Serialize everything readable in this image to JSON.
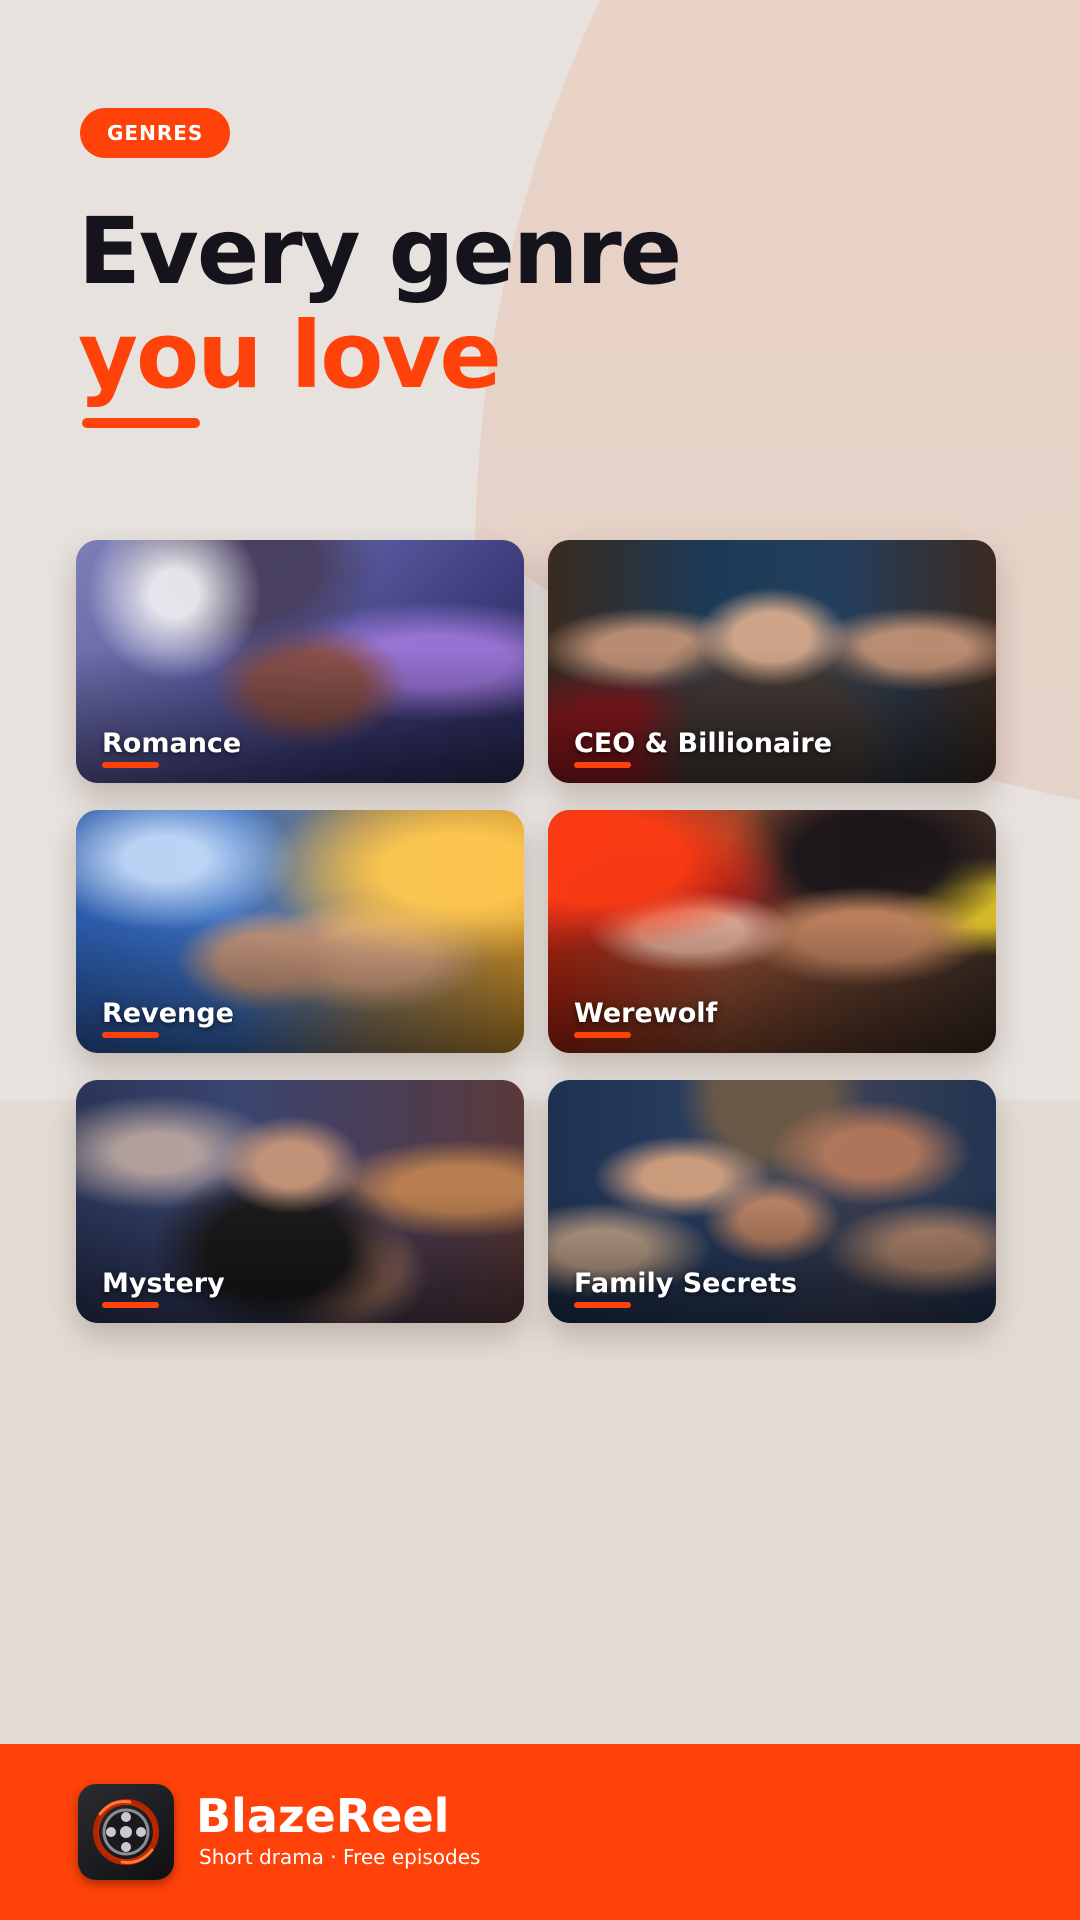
{
  "badge": {
    "label": "GENRES"
  },
  "headline": {
    "line1": "Every genre",
    "line2": "you love"
  },
  "genres": [
    {
      "label": "Romance"
    },
    {
      "label": "CEO & Billionaire"
    },
    {
      "label": "Revenge"
    },
    {
      "label": "Werewolf"
    },
    {
      "label": "Mystery"
    },
    {
      "label": "Family Secrets"
    }
  ],
  "footer": {
    "app_name": "BlazeReel",
    "tagline": "Short drama · Free episodes",
    "icon": "film-reel-icon"
  },
  "colors": {
    "accent": "#ff420a",
    "headline_dark": "#15141c",
    "background": "#e7e2de",
    "background_tint": "#e9d0c5"
  }
}
